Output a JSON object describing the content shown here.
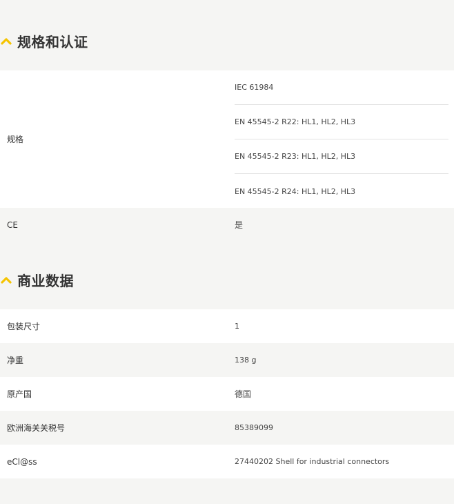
{
  "sections": [
    {
      "title": "规格和认证",
      "rows": [
        {
          "label": "规格",
          "values": [
            "IEC 61984",
            "EN 45545-2 R22: HL1, HL2, HL3",
            "EN 45545-2 R23: HL1, HL2, HL3",
            "EN 45545-2 R24: HL1, HL2, HL3"
          ]
        },
        {
          "label": "CE",
          "value": "是"
        }
      ]
    },
    {
      "title": "商业数据",
      "rows": [
        {
          "label": "包装尺寸",
          "value": "1"
        },
        {
          "label": "净重",
          "value": "138 g"
        },
        {
          "label": "原产国",
          "value": "德国"
        },
        {
          "label": "欧洲海关关税号",
          "value": "85389099"
        },
        {
          "label": "eCl@ss",
          "value": "27440202 Shell for industrial connectors"
        }
      ]
    }
  ],
  "colors": {
    "accent": "#f5c400",
    "row_white": "#ffffff",
    "row_grey": "#f5f5f3",
    "divider": "#e2e2e2"
  },
  "icons": {
    "section_toggle": "chevron-up-icon"
  }
}
